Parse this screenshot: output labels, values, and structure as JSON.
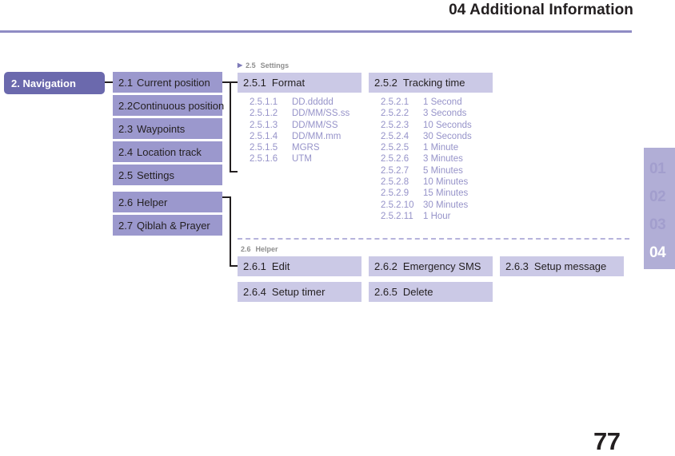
{
  "header": {
    "title": "04 Additional Information"
  },
  "side_tabs": {
    "items": [
      "01",
      "02",
      "03",
      "04"
    ],
    "active_index": 3
  },
  "page_number": "77",
  "chapter": {
    "label": "2. Navigation"
  },
  "sidebar": {
    "items": [
      {
        "num": "2.1",
        "label": "Current position"
      },
      {
        "num": "2.2",
        "label": "Continuous position"
      },
      {
        "num": "2.3",
        "label": "Waypoints"
      },
      {
        "num": "2.4",
        "label": "Location track"
      },
      {
        "num": "2.5",
        "label": "Settings"
      },
      {
        "num": "2.6",
        "label": "Helper"
      },
      {
        "num": "2.7",
        "label": "Qiblah & Prayer"
      }
    ]
  },
  "captions": {
    "settings": {
      "arrow": "▶",
      "num": "2.5",
      "label": "Settings"
    },
    "helper": {
      "num": "2.6",
      "label": "Helper"
    }
  },
  "boxes": {
    "b251": {
      "num": "2.5.1",
      "label": "Format"
    },
    "b252": {
      "num": "2.5.2",
      "label": "Tracking time"
    },
    "b261": {
      "num": "2.6.1",
      "label": "Edit"
    },
    "b262": {
      "num": "2.6.2",
      "label": "Emergency SMS"
    },
    "b263": {
      "num": "2.6.3",
      "label": "Setup message"
    },
    "b264": {
      "num": "2.6.4",
      "label": "Setup timer"
    },
    "b265": {
      "num": "2.6.5",
      "label": "Delete"
    }
  },
  "leaves": {
    "format": [
      {
        "num": "2.5.1.1",
        "label": "DD.ddddd"
      },
      {
        "num": "2.5.1.2",
        "label": "DD/MM/SS.ss"
      },
      {
        "num": "2.5.1.3",
        "label": "DD/MM/SS"
      },
      {
        "num": "2.5.1.4",
        "label": "DD/MM.mm"
      },
      {
        "num": "2.5.1.5",
        "label": "MGRS"
      },
      {
        "num": "2.5.1.6",
        "label": "UTM"
      }
    ],
    "tracking_time": [
      {
        "num": "2.5.2.1",
        "label": "1 Second"
      },
      {
        "num": "2.5.2.2",
        "label": "3 Seconds"
      },
      {
        "num": "2.5.2.3",
        "label": "10 Seconds"
      },
      {
        "num": "2.5.2.4",
        "label": "30 Seconds"
      },
      {
        "num": "2.5.2.5",
        "label": "1 Minute"
      },
      {
        "num": "2.5.2.6",
        "label": "3 Minutes"
      },
      {
        "num": "2.5.2.7",
        "label": "5 Minutes"
      },
      {
        "num": "2.5.2.8",
        "label": "10 Minutes"
      },
      {
        "num": "2.5.2.9",
        "label": "15 Minutes"
      },
      {
        "num": "2.5.2.10",
        "label": "30 Minutes"
      },
      {
        "num": "2.5.2.11",
        "label": "1 Hour"
      }
    ]
  },
  "colors": {
    "chapter_block": "#6b69ad",
    "sidebar_item": "#9b98cd",
    "content_box": "#cbc9e6",
    "leaf_text": "#9693c9",
    "rule": "#8f8cc4",
    "tab_strip": "#b1aed6"
  }
}
